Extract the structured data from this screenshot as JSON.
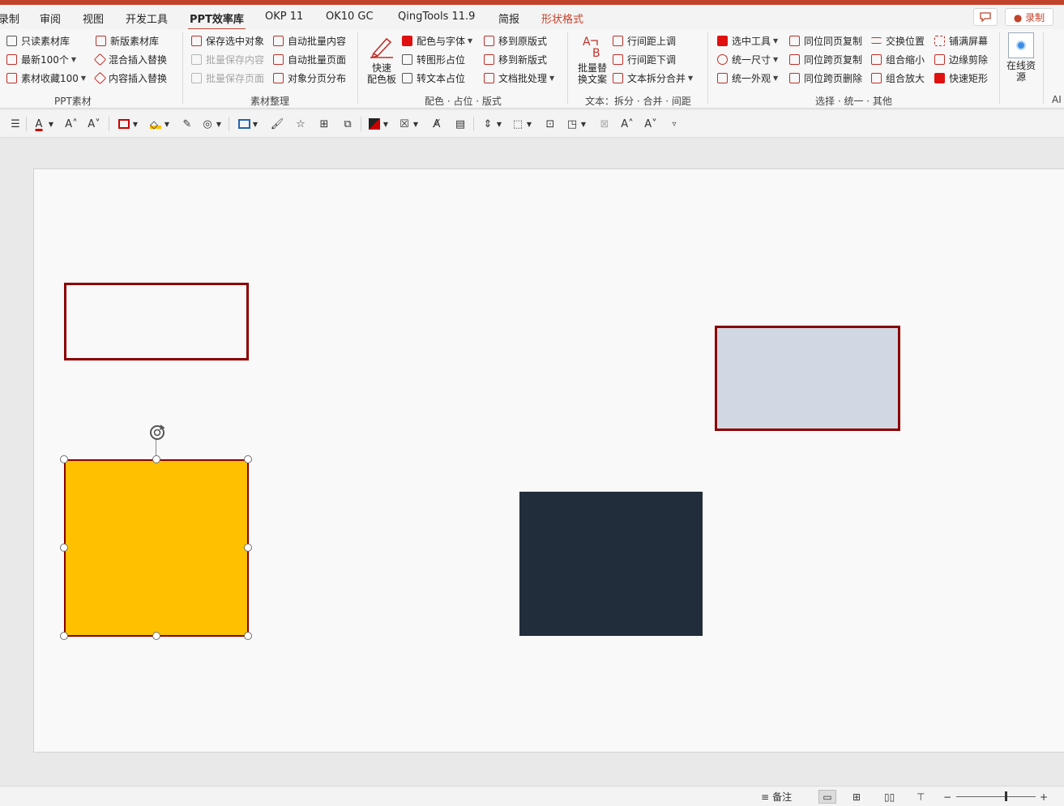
{
  "tabs": [
    {
      "label": "录制"
    },
    {
      "label": "审阅"
    },
    {
      "label": "视图"
    },
    {
      "label": "开发工具"
    },
    {
      "label": "PPT效率库"
    },
    {
      "label": "OKP 11"
    },
    {
      "label": "OK10 GC"
    },
    {
      "label": "QingTools 11.9"
    },
    {
      "label": "简报"
    },
    {
      "label": "形状格式"
    }
  ],
  "record_button": "● 录制",
  "comment_icon": "comment-icon",
  "ribbon": {
    "ppt_material": {
      "group": "PPT素材",
      "items": [
        "只读素材库",
        "新版素材库",
        "最新100个",
        "混合插入替换",
        "素材收藏100",
        "内容插入替换"
      ]
    },
    "material_org": {
      "group": "素材整理",
      "items": [
        "保存选中对象",
        "自动批量内容",
        "批量保存内容",
        "自动批量页面",
        "批量保存页面",
        "对象分页分布"
      ]
    },
    "color_layout": {
      "group": "配色 · 占位 · 版式",
      "quick_label_1": "快速",
      "quick_label_2": "配色板",
      "items": [
        "配色与字体",
        "移到原版式",
        "转图形占位",
        "移到新版式",
        "转文本占位",
        "文档批处理"
      ]
    },
    "text": {
      "group": "文本：拆分 · 合并 · 间距",
      "batch_label_1": "批量替",
      "batch_label_2": "换文案",
      "items": [
        "行间距上调",
        "行间距下调",
        "文本拆分合并"
      ]
    },
    "select_unify": {
      "group": "选择 · 统一 · 其他",
      "items": [
        "选中工具",
        "同位同页复制",
        "交换位置",
        "铺满屏幕",
        "统一尺寸",
        "同位跨页复制",
        "组合缩小",
        "边缘剪除",
        "统一外观",
        "同位跨页删除",
        "组合放大",
        "快速矩形"
      ]
    },
    "online": {
      "label_1": "在线资",
      "label_2": "源"
    },
    "ai_group": "AI"
  },
  "status": {
    "notes": "备注",
    "zoom_minus": "−",
    "zoom_plus": "+",
    "zoom_level": 0.62
  },
  "colors": {
    "accent": "#c1432b",
    "dark_red": "#8b0000",
    "yellow": "#ffc000",
    "light_blue": "#d0d8e4",
    "navy": "#222d3b",
    "slide_bg": "#f9f9f9"
  }
}
